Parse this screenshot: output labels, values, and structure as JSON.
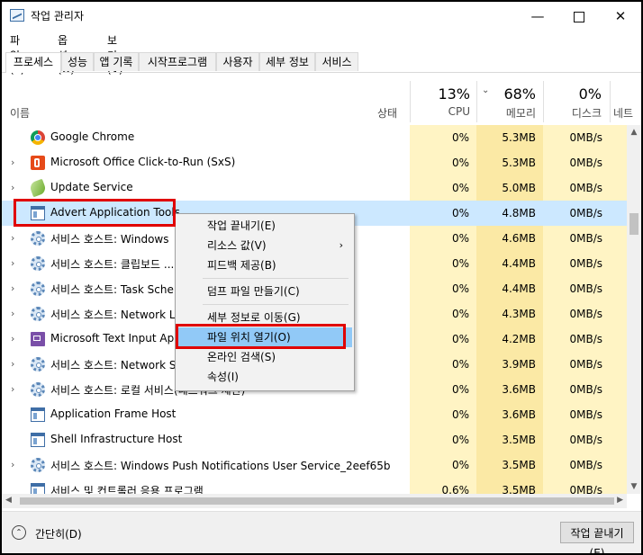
{
  "window": {
    "title": "작업 관리자",
    "minimize_glyph": "—",
    "close_glyph": "✕"
  },
  "menu": [
    {
      "label": "파일(F)"
    },
    {
      "label": "옵션(O)"
    },
    {
      "label": "보기(V)"
    }
  ],
  "tabs": [
    {
      "label": "프로세스",
      "active": true
    },
    {
      "label": "성능"
    },
    {
      "label": "앱 기록"
    },
    {
      "label": "시작프로그램"
    },
    {
      "label": "사용자"
    },
    {
      "label": "세부 정보"
    },
    {
      "label": "서비스"
    }
  ],
  "columns": {
    "name": "이름",
    "status": "상태",
    "cpu": {
      "pct": "13%",
      "label": "CPU"
    },
    "memory": {
      "pct": "68%",
      "label": "메모리"
    },
    "disk": {
      "pct": "0%",
      "label": "디스크"
    },
    "network": {
      "label": "네트"
    }
  },
  "rows": [
    {
      "name": "Google Chrome",
      "icon": "chrome-icon",
      "expand": "",
      "cpu": "0%",
      "memory": "5.3MB",
      "disk": "0MB/s"
    },
    {
      "name": "Microsoft Office Click-to-Run (SxS)",
      "icon": "office-icon",
      "expand": "›",
      "cpu": "0%",
      "memory": "5.3MB",
      "disk": "0MB/s"
    },
    {
      "name": "Update Service",
      "icon": "update-icon",
      "expand": "›",
      "cpu": "0%",
      "memory": "5.0MB",
      "disk": "0MB/s"
    },
    {
      "name": "Advert Application Tools",
      "icon": "app-window-icon",
      "expand": "",
      "cpu": "0%",
      "memory": "4.8MB",
      "disk": "0MB/s",
      "selected": true
    },
    {
      "name": "서비스 호스트: Windows",
      "icon": "gear-icon",
      "expand": "›",
      "cpu": "0%",
      "memory": "4.6MB",
      "disk": "0MB/s"
    },
    {
      "name": "서비스 호스트: 클립보드 ...",
      "icon": "gear-icon",
      "expand": "›",
      "cpu": "0%",
      "memory": "4.4MB",
      "disk": "0MB/s"
    },
    {
      "name": "서비스 호스트: Task Sche",
      "icon": "gear-icon",
      "expand": "›",
      "cpu": "0%",
      "memory": "4.4MB",
      "disk": "0MB/s"
    },
    {
      "name": "서비스 호스트: Network L",
      "icon": "gear-icon",
      "expand": "›",
      "cpu": "0%",
      "memory": "4.3MB",
      "disk": "0MB/s"
    },
    {
      "name": "Microsoft Text Input Appl",
      "icon": "text-input-icon",
      "expand": "›",
      "cpu": "0%",
      "memory": "4.2MB",
      "disk": "0MB/s"
    },
    {
      "name": "서비스 호스트: Network S",
      "icon": "gear-icon",
      "expand": "›",
      "cpu": "0%",
      "memory": "3.9MB",
      "disk": "0MB/s"
    },
    {
      "name": "서비스 호스트: 로컬 서비스(네트워크 제한)",
      "icon": "gear-icon",
      "expand": "›",
      "cpu": "0%",
      "memory": "3.6MB",
      "disk": "0MB/s"
    },
    {
      "name": "Application Frame Host",
      "icon": "app-window-icon",
      "expand": "",
      "cpu": "0%",
      "memory": "3.6MB",
      "disk": "0MB/s"
    },
    {
      "name": "Shell Infrastructure Host",
      "icon": "app-window-icon",
      "expand": "",
      "cpu": "0%",
      "memory": "3.5MB",
      "disk": "0MB/s"
    },
    {
      "name": "서비스 호스트: Windows Push Notifications User Service_2eef65b",
      "icon": "gear-icon",
      "expand": "›",
      "cpu": "0%",
      "memory": "3.5MB",
      "disk": "0MB/s"
    },
    {
      "name": "서비스 및 컨트롤러 응용 프로그램",
      "icon": "app-window-icon",
      "expand": "",
      "cpu": "0.6%",
      "memory": "3.5MB",
      "disk": "0MB/s"
    }
  ],
  "context_menu": {
    "items": [
      {
        "label": "작업 끝내기(E)"
      },
      {
        "label": "리소스 값(V)",
        "submenu": true
      },
      {
        "label": "피드백 제공(B)"
      },
      {
        "label": "덤프 파일 만들기(C)"
      },
      {
        "label": "세부 정보로 이동(G)"
      },
      {
        "label": "파일 위치 열기(O)",
        "highlighted": true
      },
      {
        "label": "온라인 검색(S)"
      },
      {
        "label": "속성(I)"
      }
    ],
    "submenu_arrow": "›"
  },
  "footer": {
    "fewer_details": "간단히(D)",
    "end_task": "작업 끝내기(E)"
  },
  "colors": {
    "selection": "#cce8ff",
    "highlight_menu": "#91c9f7",
    "annotation_red": "#e00000",
    "cpu_column": "#fff4c4",
    "memory_column": "#fbe9a5"
  }
}
